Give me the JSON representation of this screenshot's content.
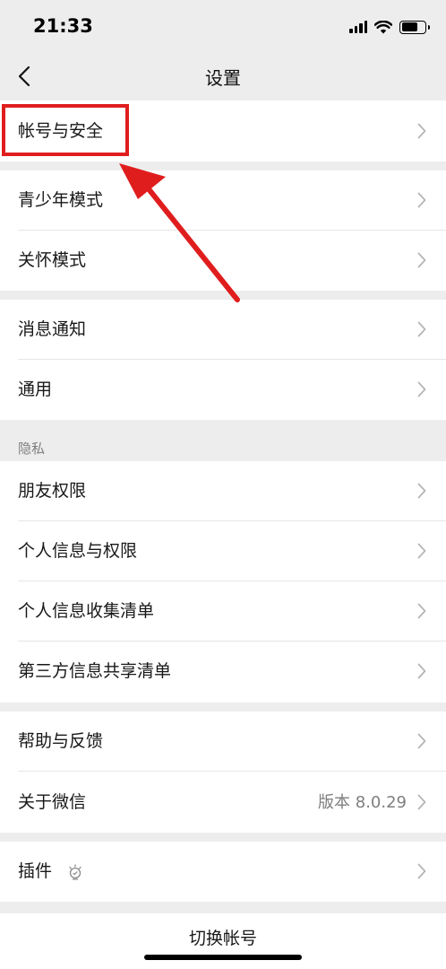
{
  "status_bar": {
    "time": "21:33"
  },
  "nav": {
    "title": "设置"
  },
  "groups": [
    {
      "items": [
        {
          "label": "帐号与安全"
        }
      ]
    },
    {
      "items": [
        {
          "label": "青少年模式"
        },
        {
          "label": "关怀模式"
        }
      ]
    },
    {
      "items": [
        {
          "label": "消息通知"
        },
        {
          "label": "通用"
        }
      ]
    },
    {
      "header": "隐私",
      "items": [
        {
          "label": "朋友权限"
        },
        {
          "label": "个人信息与权限"
        },
        {
          "label": "个人信息收集清单"
        },
        {
          "label": "第三方信息共享清单"
        }
      ]
    },
    {
      "items": [
        {
          "label": "帮助与反馈"
        },
        {
          "label": "关于微信",
          "value": "版本 8.0.29"
        }
      ]
    },
    {
      "items": [
        {
          "label": "插件",
          "icon": "plugin-bulb-icon"
        }
      ]
    }
  ],
  "footer": {
    "switch_account": "切换帐号"
  },
  "annotation": {
    "color": "#e01d1d",
    "target": "帐号与安全"
  },
  "colors": {
    "background": "#ededed",
    "row": "#ffffff",
    "annotation_red": "#e01d1d"
  }
}
